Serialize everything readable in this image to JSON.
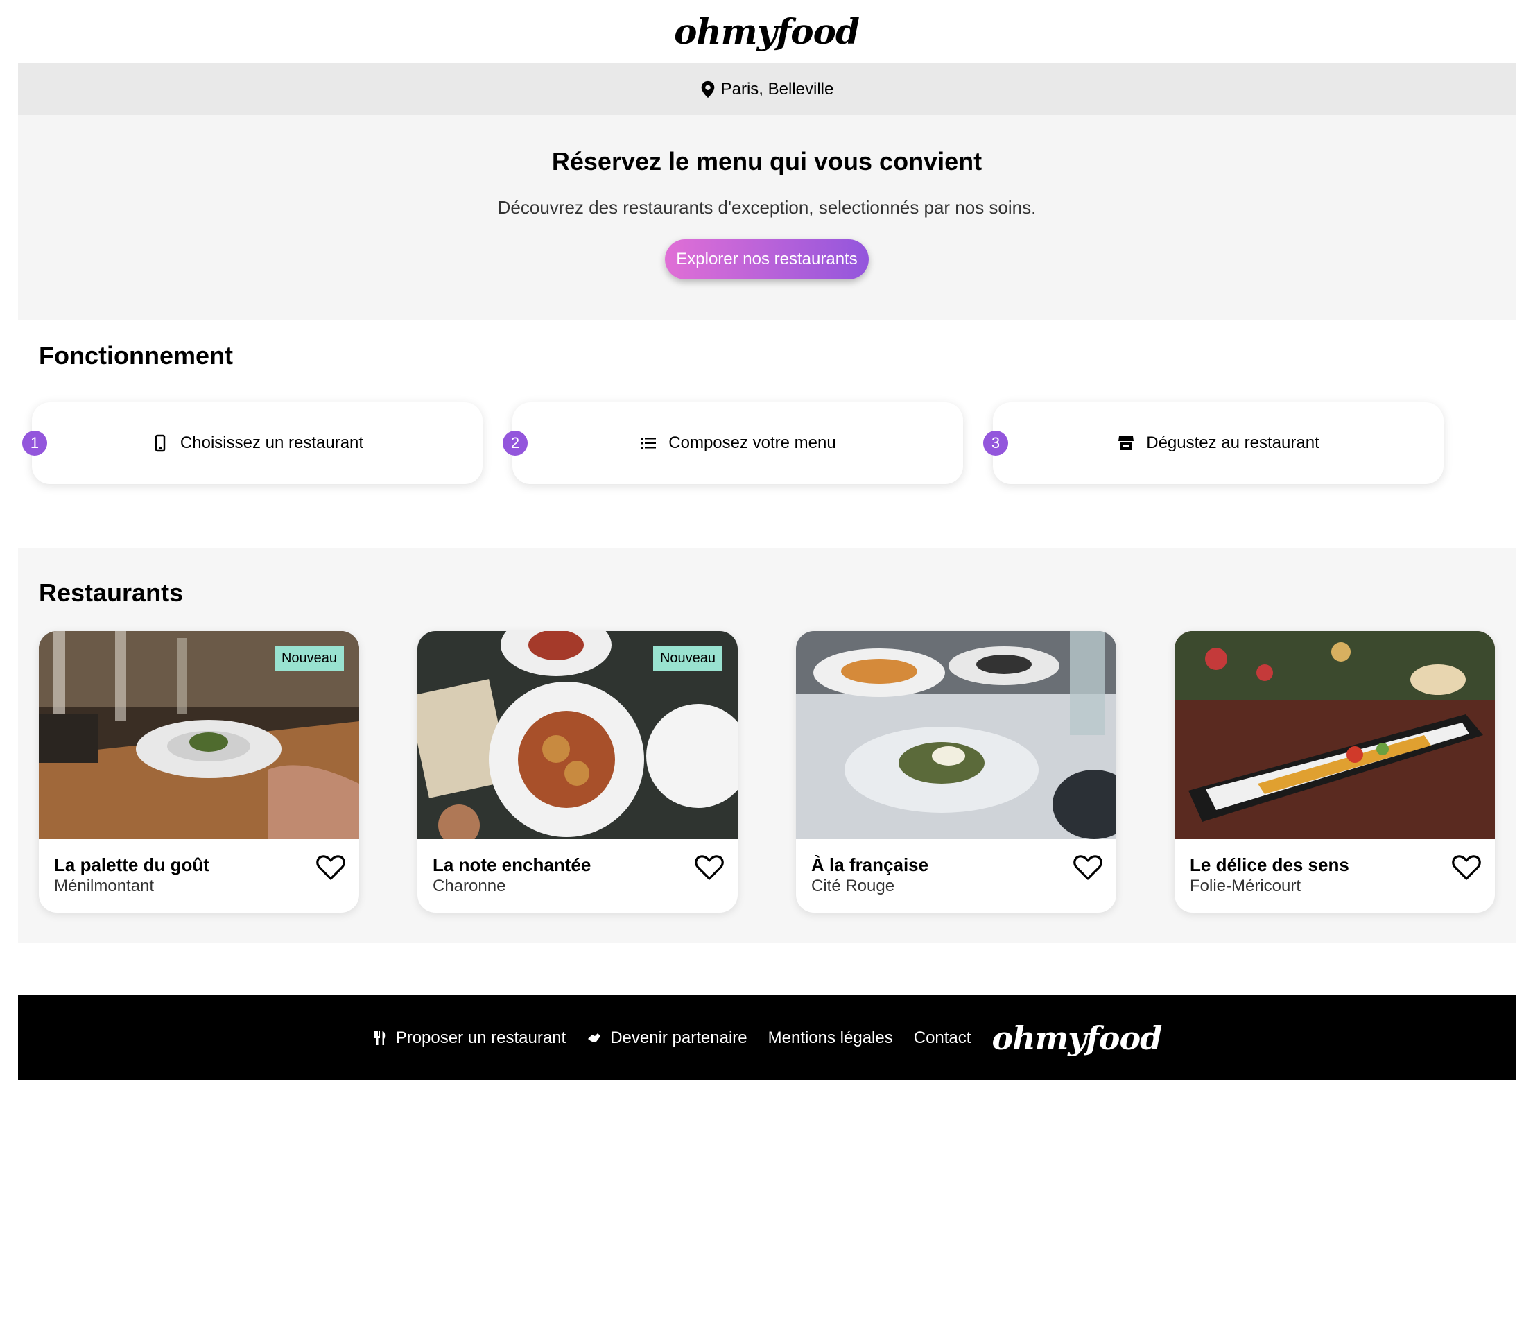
{
  "header": {
    "logo": "ohmyfood"
  },
  "location": {
    "icon": "map-pin-icon",
    "text": "Paris, Belleville"
  },
  "hero": {
    "title": "Réservez le menu qui vous convient",
    "subtitle": "Découvrez des restaurants d'exception, selectionnés par nos soins.",
    "cta_label": "Explorer nos restaurants",
    "cta_colors": [
      "#e06fd6",
      "#9356dc"
    ]
  },
  "how": {
    "title": "Fonctionnement",
    "steps": [
      {
        "number": "1",
        "icon": "phone-icon",
        "label": "Choisissez un restaurant"
      },
      {
        "number": "2",
        "icon": "list-icon",
        "label": "Composez votre menu"
      },
      {
        "number": "3",
        "icon": "store-icon",
        "label": "Dégustez au restaurant"
      }
    ]
  },
  "restaurants": {
    "title": "Restaurants",
    "items": [
      {
        "name": "La palette du goût",
        "area": "Ménilmontant",
        "badge": "Nouveau"
      },
      {
        "name": "La note enchantée",
        "area": "Charonne",
        "badge": "Nouveau"
      },
      {
        "name": "À la française",
        "area": "Cité Rouge",
        "badge": ""
      },
      {
        "name": "Le délice des sens",
        "area": "Folie-Méricourt",
        "badge": ""
      }
    ]
  },
  "footer": {
    "links": [
      {
        "icon": "utensils-icon",
        "label": "Proposer un restaurant"
      },
      {
        "icon": "handshake-icon",
        "label": "Devenir partenaire"
      },
      {
        "icon": "",
        "label": "Mentions légales"
      },
      {
        "icon": "",
        "label": "Contact"
      }
    ],
    "logo": "ohmyfood"
  },
  "colors": {
    "accent": "#9356dc",
    "badge": "#99e2d0",
    "footer_bg": "#000000",
    "band_bg": "#e9e9e9"
  }
}
